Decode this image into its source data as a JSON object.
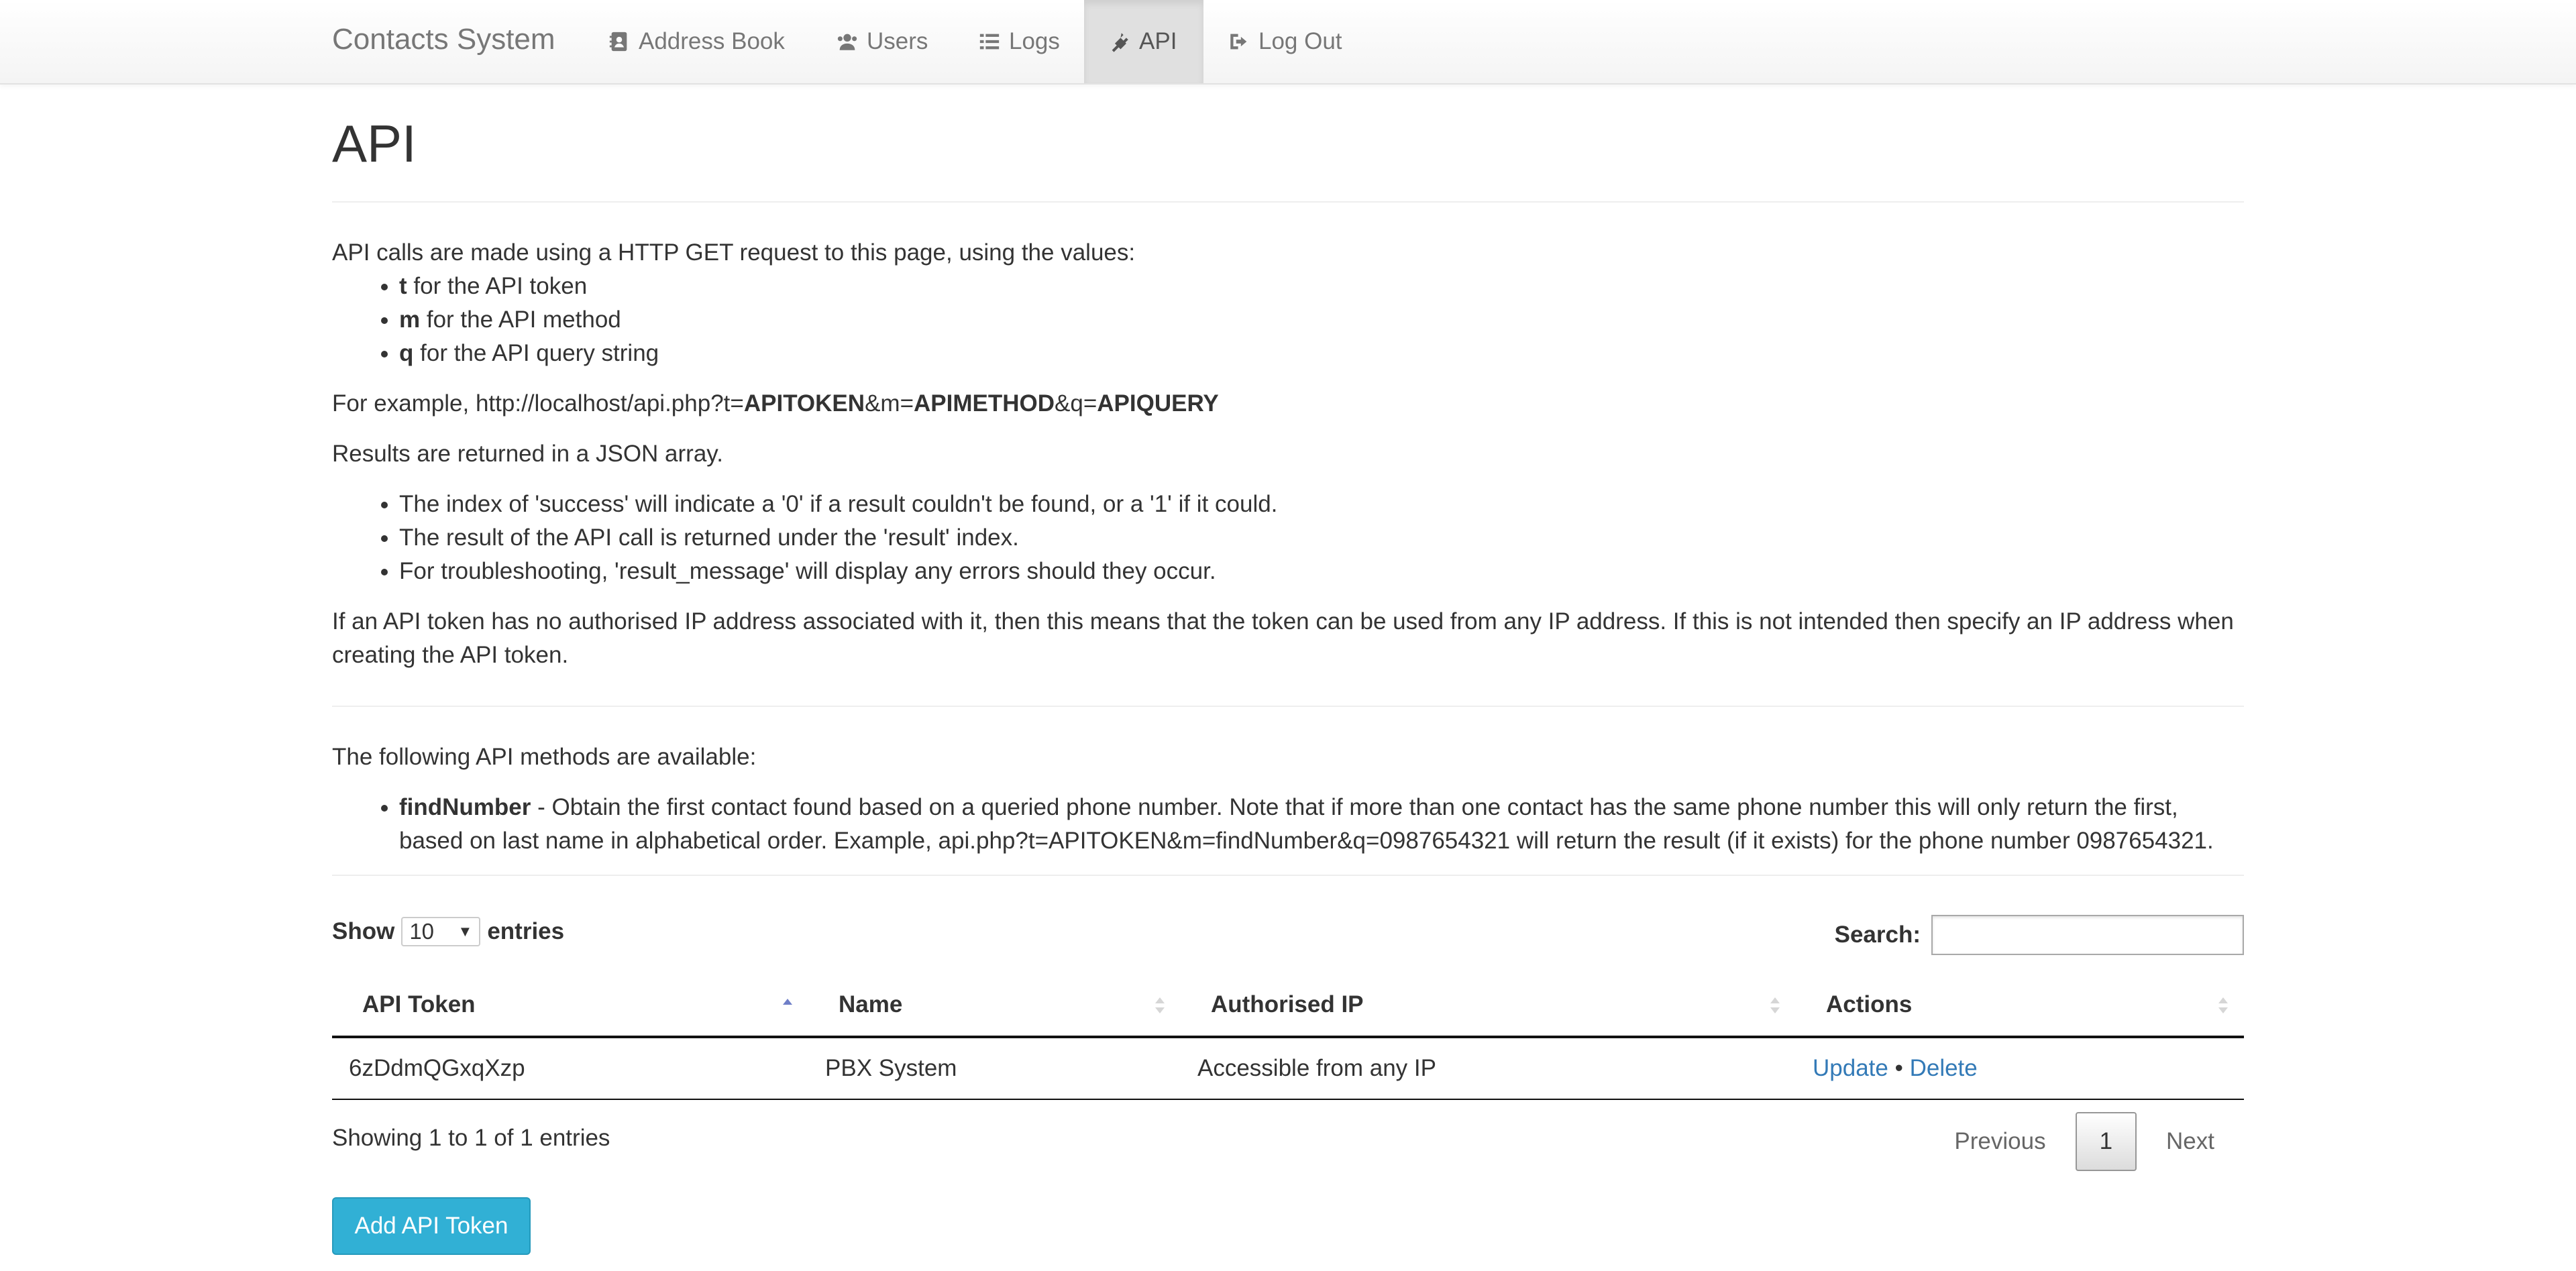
{
  "navbar": {
    "brand": "Contacts System",
    "items": [
      {
        "label": "Address Book",
        "icon": "address-book-icon"
      },
      {
        "label": "Users",
        "icon": "users-icon"
      },
      {
        "label": "Logs",
        "icon": "list-icon"
      },
      {
        "label": "API",
        "icon": "plug-icon",
        "active": true
      },
      {
        "label": "Log Out",
        "icon": "sign-out-icon"
      }
    ]
  },
  "page": {
    "title": "API",
    "intro": "API calls are made using a HTTP GET request to this page, using the values:",
    "params": [
      {
        "key": "t",
        "desc": "for the API token"
      },
      {
        "key": "m",
        "desc": "for the API method"
      },
      {
        "key": "q",
        "desc": "for the API query string"
      }
    ],
    "example_prefix": "For example, http://localhost/api.php?t=",
    "example_token": "APITOKEN",
    "example_m": "&m=",
    "example_method": "APIMETHOD",
    "example_q": "&q=",
    "example_query": "APIQUERY",
    "results_intro": "Results are returned in a JSON array.",
    "results": [
      "The index of 'success' will indicate a '0' if a result couldn't be found, or a '1' if it could.",
      "The result of the API call is returned under the 'result' index.",
      "For troubleshooting, 'result_message' will display any errors should they occur."
    ],
    "ip_note": "If an API token has no authorised IP address associated with it, then this means that the token can be used from any IP address. If this is not intended then specify an IP address when creating the API token.",
    "methods_intro": "The following API methods are available:",
    "methods": [
      {
        "name": "findNumber",
        "desc": " - Obtain the first contact found based on a queried phone number. Note that if more than one contact has the same phone number this will only return the first, based on last name in alphabetical order. Example, api.php?t=APITOKEN&m=findNumber&q=0987654321 will return the result (if it exists) for the phone number 0987654321."
      }
    ]
  },
  "table": {
    "show_label": "Show",
    "entries_label": "entries",
    "page_size": "10",
    "search_label": "Search:",
    "search_value": "",
    "columns": [
      "API Token",
      "Name",
      "Authorised IP",
      "Actions"
    ],
    "rows": [
      {
        "token": "6zDdmQGxqXzp",
        "name": "PBX System",
        "ip": "Accessible from any IP",
        "update": "Update",
        "sep": " • ",
        "delete": "Delete"
      }
    ],
    "info": "Showing 1 to 1 of 1 entries",
    "prev": "Previous",
    "current_page": "1",
    "next": "Next"
  },
  "add_button": "Add API Token",
  "colors": {
    "link": "#337ab7",
    "add_button": "#31b0d5",
    "sort_active": "#6f7fc8"
  }
}
